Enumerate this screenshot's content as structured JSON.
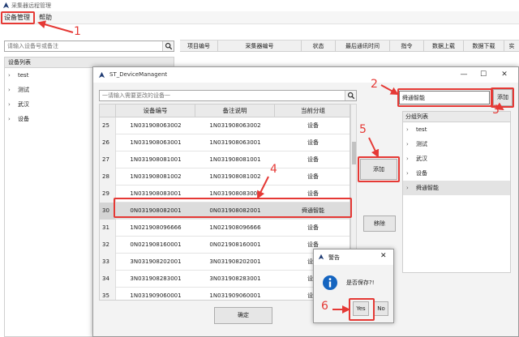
{
  "window": {
    "title": "采集器远程管理"
  },
  "menubar": {
    "items": [
      "设备管理",
      "帮助"
    ]
  },
  "left": {
    "search_placeholder": "请输入设备号或备注",
    "panel_title": "设备列表",
    "items": [
      "test",
      "测试",
      "武汉",
      "设备"
    ]
  },
  "main_table": {
    "columns": [
      "项目编号",
      "采集器编号",
      "状态",
      "最后通讯时间",
      "指令",
      "数据上载",
      "数据下载",
      "实"
    ]
  },
  "dialog": {
    "title": "ST_DeviceManagent",
    "search_placeholder": "一请输入需要更改的设备一",
    "columns": [
      "",
      "设备编号",
      "备注说明",
      "当前分组"
    ],
    "rows": [
      {
        "idx": "25",
        "device": "1N031908063002",
        "remark": "1N031908063002",
        "group": "设备"
      },
      {
        "idx": "26",
        "device": "1N031908063001",
        "remark": "1N031908063001",
        "group": "设备"
      },
      {
        "idx": "27",
        "device": "1N031908081001",
        "remark": "1N031908081001",
        "group": "设备"
      },
      {
        "idx": "28",
        "device": "1N031908081002",
        "remark": "1N031908081002",
        "group": "设备"
      },
      {
        "idx": "29",
        "device": "1N031908083001",
        "remark": "1N031908083001",
        "group": "设备"
      },
      {
        "idx": "30",
        "device": "0N031908082001",
        "remark": "0N031908082001",
        "group": "舜通智能"
      },
      {
        "idx": "31",
        "device": "1N021908096666",
        "remark": "1N021908096666",
        "group": "设备"
      },
      {
        "idx": "32",
        "device": "0N021908160001",
        "remark": "0N021908160001",
        "group": "设备"
      },
      {
        "idx": "33",
        "device": "3N031908202001",
        "remark": "3N031908202001",
        "group": "设备"
      },
      {
        "idx": "34",
        "device": "3N031908283001",
        "remark": "3N031908283001",
        "group": "设备"
      },
      {
        "idx": "35",
        "device": "1N031909060001",
        "remark": "1N031909060001",
        "group": "设备"
      }
    ],
    "group_input_value": "舜通智能",
    "add_group_label": "添加",
    "group_list_title": "分组列表",
    "groups": [
      "test",
      "测试",
      "武汉",
      "设备",
      "舜通智能"
    ],
    "add_button_label": "添加",
    "remove_button_label": "移除",
    "confirm_button_label": "确定"
  },
  "alert": {
    "title": "警告",
    "message": "是否保存?!",
    "yes_label": "Yes",
    "no_label": "No"
  },
  "annotations": [
    "1",
    "2",
    "3",
    "4",
    "5",
    "6"
  ],
  "colors": {
    "annotation_red": "#e53935",
    "info_icon_blue": "#1565c0"
  }
}
